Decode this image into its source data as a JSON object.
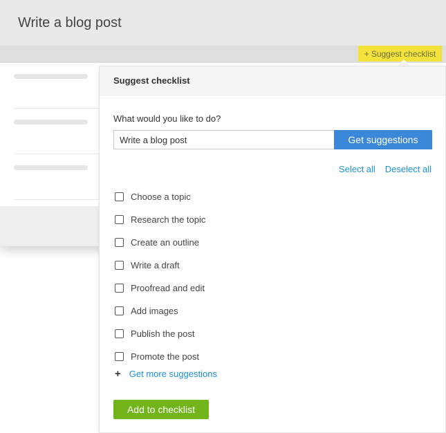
{
  "task": {
    "title": "Write a blog post",
    "suggest_tab_label": "Suggest checklist",
    "suggest_tab_icon": "plus-icon"
  },
  "popover": {
    "title": "Suggest checklist",
    "prompt_label": "What would you like to do?",
    "input_value": "Write a blog post",
    "get_suggestions_label": "Get suggestions",
    "select_all_label": "Select all",
    "deselect_all_label": "Deselect all",
    "items": [
      {
        "label": "Choose a topic",
        "checked": false
      },
      {
        "label": "Research the topic",
        "checked": false
      },
      {
        "label": "Create an outline",
        "checked": false
      },
      {
        "label": "Write a draft",
        "checked": false
      },
      {
        "label": "Proofread and edit",
        "checked": false
      },
      {
        "label": "Add images",
        "checked": false
      },
      {
        "label": "Publish the post",
        "checked": false
      },
      {
        "label": "Promote the post",
        "checked": false
      }
    ],
    "more_label": "Get more suggestions",
    "add_button_label": "Add to checklist"
  },
  "colors": {
    "accent_blue": "#3b88d8",
    "link_blue": "#1a8fd8",
    "add_green": "#72b51a",
    "tab_yellow": "#f3e23c"
  }
}
